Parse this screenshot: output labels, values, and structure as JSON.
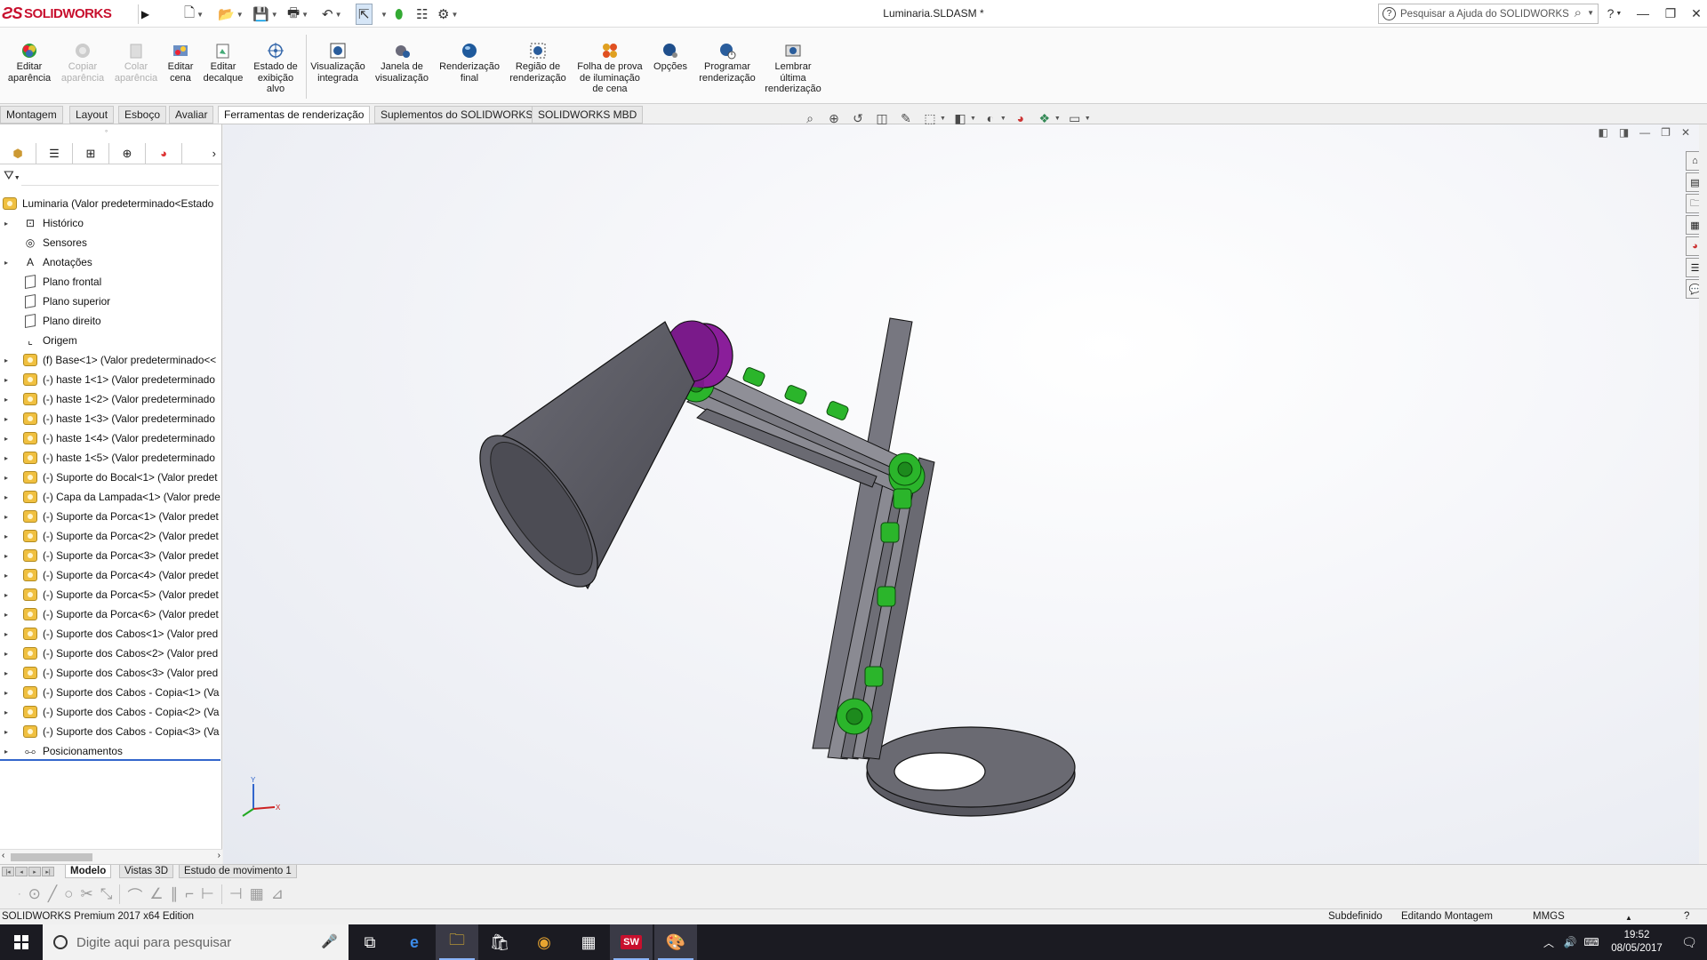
{
  "app": {
    "brand": "SOLIDWORKS",
    "document_title": "Luminaria.SLDASM *"
  },
  "help_search": {
    "placeholder": "Pesquisar a Ajuda do SOLIDWORKS"
  },
  "window_controls": [
    "?",
    "—",
    "❐",
    "✕"
  ],
  "ribbon": {
    "buttons": [
      {
        "label": "Editar\naparência",
        "icon": "edit-appearance-icon",
        "enabled": true
      },
      {
        "label": "Copiar\naparência",
        "icon": "copy-appearance-icon",
        "enabled": false
      },
      {
        "label": "Colar\naparência",
        "icon": "paste-appearance-icon",
        "enabled": false
      },
      {
        "label": "Editar\ncena",
        "icon": "edit-scene-icon",
        "enabled": true
      },
      {
        "label": "Editar\ndecalque",
        "icon": "edit-decal-icon",
        "enabled": true
      },
      {
        "label": "Estado de\nexibição\nalvo",
        "icon": "display-state-icon",
        "enabled": true
      },
      {
        "label": "Visualização\nintegrada",
        "icon": "integrated-preview-icon",
        "enabled": true
      },
      {
        "label": "Janela de\nvisualização",
        "icon": "preview-window-icon",
        "enabled": true
      },
      {
        "label": "Renderização\nfinal",
        "icon": "final-render-icon",
        "enabled": true
      },
      {
        "label": "Região de\nrenderização",
        "icon": "render-region-icon",
        "enabled": true
      },
      {
        "label": "Folha de prova\nde iluminação\nde cena",
        "icon": "scene-illumination-proof-icon",
        "enabled": true
      },
      {
        "label": "Opções",
        "icon": "options-icon",
        "enabled": true
      },
      {
        "label": "Programar\nrenderização",
        "icon": "schedule-render-icon",
        "enabled": true
      },
      {
        "label": "Lembrar\núltima\nrenderização",
        "icon": "recall-last-render-icon",
        "enabled": true
      }
    ]
  },
  "tabs": [
    {
      "label": "Montagem",
      "active": false
    },
    {
      "label": "Layout",
      "active": false
    },
    {
      "label": "Esboço",
      "active": false
    },
    {
      "label": "Avaliar",
      "active": false
    },
    {
      "label": "Ferramentas de renderização",
      "active": true
    },
    {
      "label": "Suplementos do SOLIDWORKS",
      "active": false
    },
    {
      "label": "SOLIDWORKS MBD",
      "active": false
    }
  ],
  "feature_tree": {
    "root": "Luminaria  (Valor predeterminado<Estado",
    "items": [
      {
        "label": "Histórico",
        "icon": "history-icon",
        "expandable": true
      },
      {
        "label": "Sensores",
        "icon": "sensors-icon",
        "expandable": false
      },
      {
        "label": "Anotações",
        "icon": "annotations-icon",
        "expandable": true
      },
      {
        "label": "Plano frontal",
        "icon": "plane-icon",
        "expandable": false
      },
      {
        "label": "Plano superior",
        "icon": "plane-icon",
        "expandable": false
      },
      {
        "label": "Plano direito",
        "icon": "plane-icon",
        "expandable": false
      },
      {
        "label": "Origem",
        "icon": "origin-icon",
        "expandable": false
      },
      {
        "label": "(f) Base<1> (Valor predeterminado<<",
        "icon": "component-icon",
        "expandable": true
      },
      {
        "label": "(-) haste 1<1> (Valor predeterminado",
        "icon": "component-icon",
        "expandable": true
      },
      {
        "label": "(-) haste 1<2> (Valor predeterminado",
        "icon": "component-icon",
        "expandable": true
      },
      {
        "label": "(-) haste 1<3> (Valor predeterminado",
        "icon": "component-icon",
        "expandable": true
      },
      {
        "label": "(-) haste 1<4> (Valor predeterminado",
        "icon": "component-icon",
        "expandable": true
      },
      {
        "label": "(-) haste 1<5> (Valor predeterminado",
        "icon": "component-icon",
        "expandable": true
      },
      {
        "label": "(-) Suporte do Bocal<1> (Valor predet",
        "icon": "component-icon",
        "expandable": true
      },
      {
        "label": "(-) Capa da Lampada<1> (Valor prede",
        "icon": "component-icon",
        "expandable": true
      },
      {
        "label": "(-) Suporte da Porca<1> (Valor predet",
        "icon": "component-icon",
        "expandable": true
      },
      {
        "label": "(-) Suporte da Porca<2> (Valor predet",
        "icon": "component-icon",
        "expandable": true
      },
      {
        "label": "(-) Suporte da Porca<3> (Valor predet",
        "icon": "component-icon",
        "expandable": true
      },
      {
        "label": "(-) Suporte da Porca<4> (Valor predet",
        "icon": "component-icon",
        "expandable": true
      },
      {
        "label": "(-) Suporte da Porca<5> (Valor predet",
        "icon": "component-icon",
        "expandable": true
      },
      {
        "label": "(-) Suporte da Porca<6> (Valor predet",
        "icon": "component-icon",
        "expandable": true
      },
      {
        "label": "(-) Suporte dos Cabos<1> (Valor pred",
        "icon": "component-icon",
        "expandable": true
      },
      {
        "label": "(-) Suporte dos Cabos<2> (Valor pred",
        "icon": "component-icon",
        "expandable": true
      },
      {
        "label": "(-) Suporte dos Cabos<3> (Valor pred",
        "icon": "component-icon",
        "expandable": true
      },
      {
        "label": "(-) Suporte dos Cabos - Copia<1> (Va",
        "icon": "component-icon",
        "expandable": true
      },
      {
        "label": "(-) Suporte dos Cabos - Copia<2> (Va",
        "icon": "component-icon",
        "expandable": true
      },
      {
        "label": "(-) Suporte dos Cabos - Copia<3> (Va",
        "icon": "component-icon",
        "expandable": true
      },
      {
        "label": "Posicionamentos",
        "icon": "mates-icon",
        "expandable": true
      }
    ]
  },
  "model_tabs": [
    {
      "label": "Modelo",
      "active": true
    },
    {
      "label": "Vistas 3D",
      "active": false
    },
    {
      "label": "Estudo de movimento 1",
      "active": false
    }
  ],
  "status_bar": {
    "product": "SOLIDWORKS Premium 2017 x64 Edition",
    "definition": "Subdefinido",
    "mode": "Editando Montagem",
    "units": "MMGS"
  },
  "taskbar": {
    "search_placeholder": "Digite aqui para pesquisar",
    "time": "19:52",
    "date": "08/05/2017"
  },
  "colors": {
    "brand_red": "#c8102e",
    "lamp_shade": "#5a5a62",
    "lamp_cap": "#7a1a8a",
    "joint_green": "#2bb52b",
    "tree_end_line": "#3366cc"
  }
}
